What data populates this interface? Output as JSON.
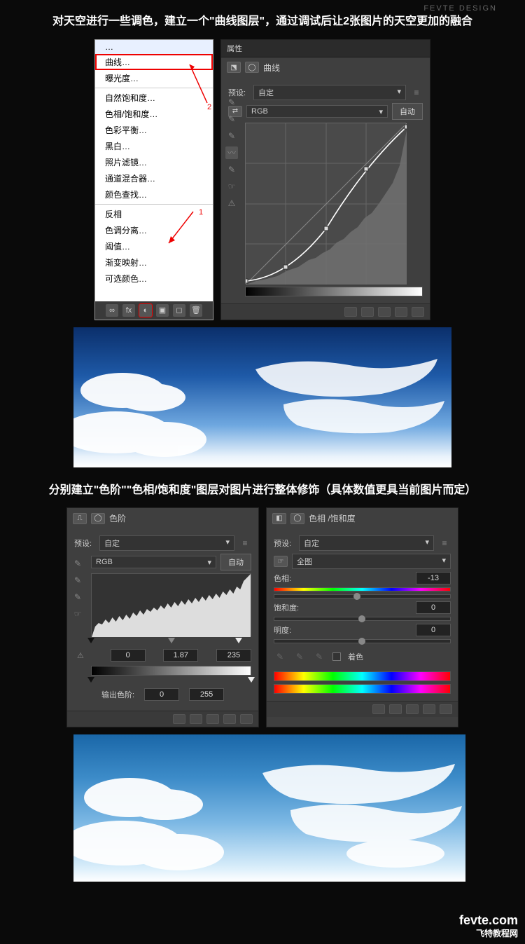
{
  "topmark": "FEVTE DESIGN",
  "heading1": "对天空进行一些调色，建立一个\"曲线图层\"，通过调试后让2张图片的天空更加的融合",
  "heading2": "分别建立\"色阶\"\"色相/饱和度\"图层对图片进行整体修饰（具体数值更具当前图片而定）",
  "menu": {
    "items": [
      "曲线…",
      "曝光度…",
      "自然饱和度…",
      "色相/饱和度…",
      "色彩平衡…",
      "黑白…",
      "照片滤镜…",
      "通道混合器…",
      "颜色查找…",
      "反相",
      "色调分离…",
      "阈值…",
      "渐变映射…",
      "可选颜色…"
    ],
    "mark1": "1",
    "mark2": "2"
  },
  "curves": {
    "panel_tab": "属性",
    "title": "曲线",
    "preset_lbl": "预设:",
    "preset_val": "自定",
    "channel": "RGB",
    "auto": "自动"
  },
  "levels": {
    "title": "色阶",
    "preset_lbl": "预设:",
    "preset_val": "自定",
    "channel": "RGB",
    "auto": "自动",
    "in": [
      "0",
      "1.87",
      "235"
    ],
    "out_lbl": "输出色阶:",
    "out": [
      "0",
      "255"
    ]
  },
  "huesat": {
    "title": "色相 /饱和度",
    "preset_lbl": "预设:",
    "preset_val": "自定",
    "scope": "全图",
    "hue_lbl": "色相:",
    "hue_val": "-13",
    "sat_lbl": "饱和度:",
    "sat_val": "0",
    "lig_lbl": "明度:",
    "lig_val": "0",
    "colorize": "着色"
  },
  "watermark": {
    "line1": "fevte.com",
    "line2": "飞特教程网"
  }
}
